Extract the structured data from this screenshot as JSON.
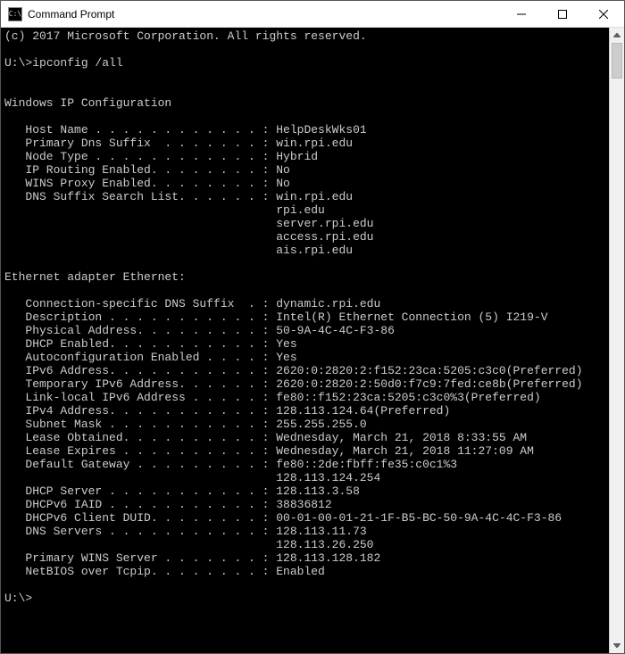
{
  "window": {
    "title": "Command Prompt",
    "icon_label": "C:\\"
  },
  "console": {
    "copyright": "(c) 2017 Microsoft Corporation. All rights reserved.",
    "prompt1": "U:\\>",
    "command": "ipconfig /all",
    "header": "Windows IP Configuration",
    "host_name_label": "   Host Name . . . . . . . . . . . . : ",
    "host_name": "HelpDeskWks01",
    "primary_dns_label": "   Primary Dns Suffix  . . . . . . . : ",
    "primary_dns": "win.rpi.edu",
    "node_type_label": "   Node Type . . . . . . . . . . . . : ",
    "node_type": "Hybrid",
    "ip_routing_label": "   IP Routing Enabled. . . . . . . . : ",
    "ip_routing": "No",
    "wins_proxy_label": "   WINS Proxy Enabled. . . . . . . . : ",
    "wins_proxy": "No",
    "dns_search_label": "   DNS Suffix Search List. . . . . . : ",
    "dns_search_1": "win.rpi.edu",
    "dns_search_2": "                                       rpi.edu",
    "dns_search_3": "                                       server.rpi.edu",
    "dns_search_4": "                                       access.rpi.edu",
    "dns_search_5": "                                       ais.rpi.edu",
    "adapter_header": "Ethernet adapter Ethernet:",
    "conn_dns_label": "   Connection-specific DNS Suffix  . : ",
    "conn_dns": "dynamic.rpi.edu",
    "description_label": "   Description . . . . . . . . . . . : ",
    "description": "Intel(R) Ethernet Connection (5) I219-V",
    "phys_addr_label": "   Physical Address. . . . . . . . . : ",
    "phys_addr": "50-9A-4C-4C-F3-86",
    "dhcp_en_label": "   DHCP Enabled. . . . . . . . . . . : ",
    "dhcp_en": "Yes",
    "autoconf_label": "   Autoconfiguration Enabled . . . . : ",
    "autoconf": "Yes",
    "ipv6_label": "   IPv6 Address. . . . . . . . . . . : ",
    "ipv6": "2620:0:2820:2:f152:23ca:5205:c3c0(Preferred)",
    "tmp_ipv6_label": "   Temporary IPv6 Address. . . . . . : ",
    "tmp_ipv6": "2620:0:2820:2:50d0:f7c9:7fed:ce8b(Preferred)",
    "ll_ipv6_label": "   Link-local IPv6 Address . . . . . : ",
    "ll_ipv6": "fe80::f152:23ca:5205:c3c0%3(Preferred)",
    "ipv4_label": "   IPv4 Address. . . . . . . . . . . : ",
    "ipv4": "128.113.124.64(Preferred)",
    "subnet_label": "   Subnet Mask . . . . . . . . . . . : ",
    "subnet": "255.255.255.0",
    "lease_obt_label": "   Lease Obtained. . . . . . . . . . : ",
    "lease_obt": "Wednesday, March 21, 2018 8:33:55 AM",
    "lease_exp_label": "   Lease Expires . . . . . . . . . . : ",
    "lease_exp": "Wednesday, March 21, 2018 11:27:09 AM",
    "gateway_label": "   Default Gateway . . . . . . . . . : ",
    "gateway_1": "fe80::2de:fbff:fe35:c0c1%3",
    "gateway_2": "                                       128.113.124.254",
    "dhcp_srv_label": "   DHCP Server . . . . . . . . . . . : ",
    "dhcp_srv": "128.113.3.58",
    "dhcpv6_iaid_label": "   DHCPv6 IAID . . . . . . . . . . . : ",
    "dhcpv6_iaid": "38836812",
    "dhcpv6_duid_label": "   DHCPv6 Client DUID. . . . . . . . : ",
    "dhcpv6_duid": "00-01-00-01-21-1F-B5-BC-50-9A-4C-4C-F3-86",
    "dns_srv_label": "   DNS Servers . . . . . . . . . . . : ",
    "dns_srv_1": "128.113.11.73",
    "dns_srv_2": "                                       128.113.26.250",
    "wins_srv_label": "   Primary WINS Server . . . . . . . : ",
    "wins_srv": "128.113.128.182",
    "netbios_label": "   NetBIOS over Tcpip. . . . . . . . : ",
    "netbios": "Enabled",
    "prompt2": "U:\\>"
  }
}
